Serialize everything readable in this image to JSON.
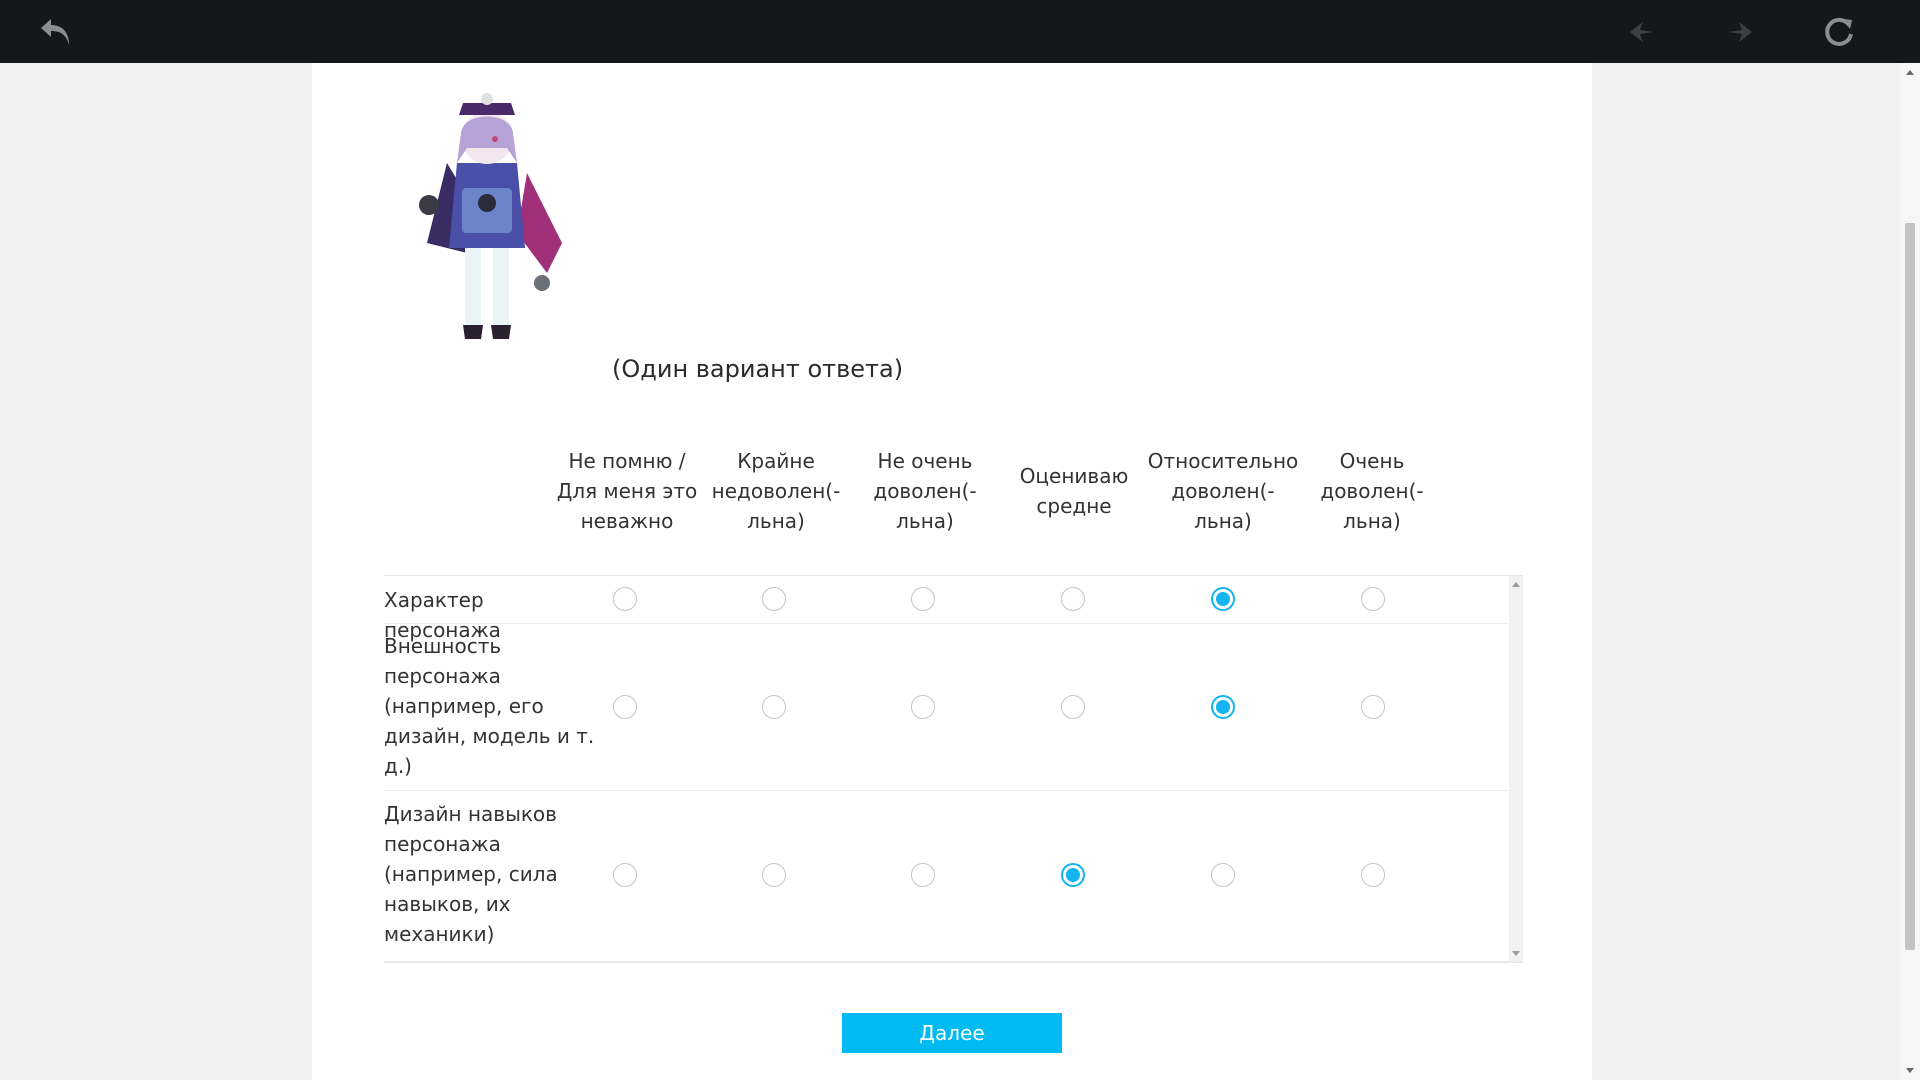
{
  "toolbar": {
    "back_icon": "back-arrow-icon",
    "prev_icon": "previous-icon",
    "next_icon": "next-icon",
    "reload_icon": "reload-icon"
  },
  "question": {
    "instruction": "(Один вариант ответа)",
    "columns": [
      "Не помню / Для меня это неважно",
      "Крайне недоволен(-льна)",
      "Не очень доволен(-льна)",
      "Оцениваю средне",
      "Относительно доволен(-льна)",
      "Очень доволен(-льна)"
    ],
    "rows": [
      {
        "label": "Характер персонажа",
        "selected": 4
      },
      {
        "label": "Внешность персонажа (например, его дизайн, модель и т. д.)",
        "selected": 4
      },
      {
        "label": "Дизайн навыков персонажа (например, сила навыков, их механики)",
        "selected": 3
      }
    ]
  },
  "next_button_label": "Далее",
  "colors": {
    "accent": "#00baf2",
    "radio_checked": "#12b5f0",
    "topbar": "#15171b"
  }
}
